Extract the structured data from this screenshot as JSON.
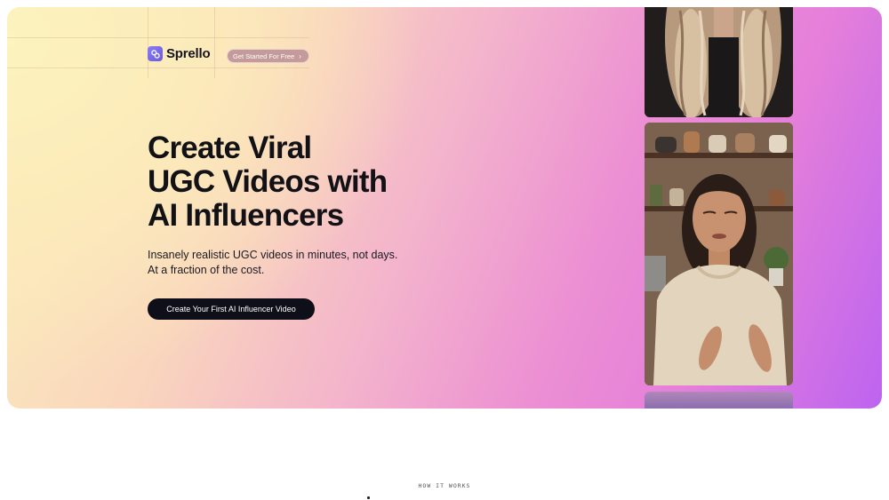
{
  "header": {
    "logo_text": "Sprello",
    "cta_pill_label": "Get Started For Free",
    "cta_pill_icon": "chevron-right-icon"
  },
  "hero": {
    "headline_lines": [
      "Create Viral",
      "UGC Videos with",
      "AI Influencers"
    ],
    "subtext_lines": [
      "Insanely realistic UGC videos in minutes, not days.",
      "At a fraction of the cost."
    ],
    "main_cta_label": "Create Your First AI Influencer Video"
  },
  "section": {
    "eyebrow": "HOW IT WORKS"
  },
  "colors": {
    "gradient_start": "#fcefbd",
    "gradient_mid": "#f3b3cc",
    "gradient_end": "#bd64f0",
    "cta_background": "#0e0f18",
    "pill_background": "#c49a9a",
    "logo_accent": "#7b6cf0"
  }
}
